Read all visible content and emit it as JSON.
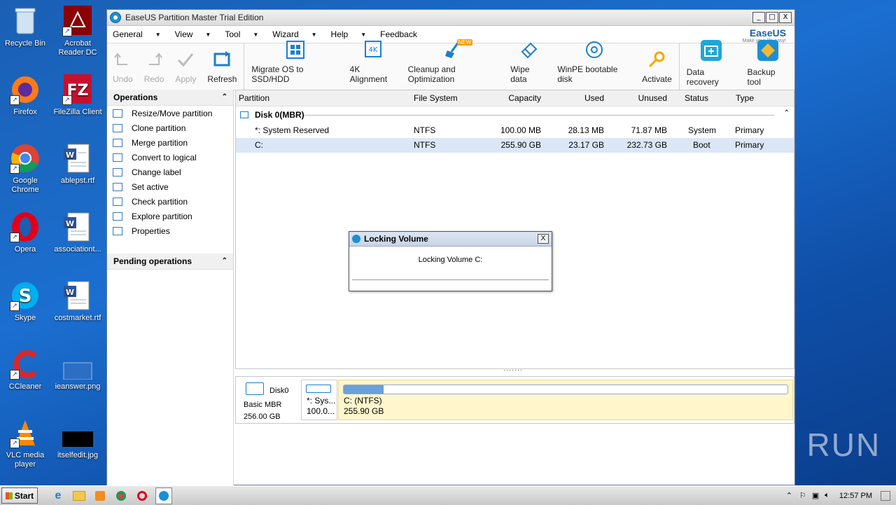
{
  "desktop": {
    "icons": [
      {
        "label": "Recycle Bin"
      },
      {
        "label": "Acrobat Reader DC"
      },
      {
        "label": "Firefox"
      },
      {
        "label": "FileZilla Client"
      },
      {
        "label": "Google Chrome"
      },
      {
        "label": "ablepst.rtf"
      },
      {
        "label": "Opera"
      },
      {
        "label": "associationt..."
      },
      {
        "label": "Skype"
      },
      {
        "label": "costmarket.rtf"
      },
      {
        "label": "CCleaner"
      },
      {
        "label": "ieanswer.png"
      },
      {
        "label": "VLC media player"
      },
      {
        "label": "itselfedit.jpg"
      }
    ]
  },
  "window": {
    "title": "EaseUS Partition Master Trial Edition",
    "buttons": {
      "minimize": "_",
      "maximize": "□",
      "close": "X"
    }
  },
  "menu": {
    "items": [
      "General",
      "View",
      "Tool",
      "Wizard",
      "Help",
      "Feedback"
    ],
    "logo_brand": "EaseUS",
    "logo_tag": "Make your life easy!"
  },
  "toolbar": {
    "undo": "Undo",
    "redo": "Redo",
    "apply": "Apply",
    "refresh": "Refresh",
    "migrate": "Migrate OS to SSD/HDD",
    "align4k": "4K Alignment",
    "cleanup": "Cleanup and Optimization",
    "new_badge": "NEW",
    "wipe": "Wipe data",
    "winpe": "WinPE bootable disk",
    "activate": "Activate",
    "data_recovery": "Data recovery",
    "backup": "Backup tool"
  },
  "operations": {
    "header": "Operations",
    "items": [
      "Resize/Move partition",
      "Clone partition",
      "Merge partition",
      "Convert to logical",
      "Change label",
      "Set active",
      "Check partition",
      "Explore partition",
      "Properties"
    ]
  },
  "pending": {
    "header": "Pending operations"
  },
  "table": {
    "headers": [
      "Partition",
      "File System",
      "Capacity",
      "Used",
      "Unused",
      "Status",
      "Type"
    ],
    "disk_label": "Disk 0(MBR)",
    "rows": [
      {
        "partition": "*: System Reserved",
        "fs": "NTFS",
        "capacity": "100.00 MB",
        "used": "28.13 MB",
        "unused": "71.87 MB",
        "status": "System",
        "type": "Primary"
      },
      {
        "partition": "C:",
        "fs": "NTFS",
        "capacity": "255.90 GB",
        "used": "23.17 GB",
        "unused": "232.73 GB",
        "status": "Boot",
        "type": "Primary"
      }
    ]
  },
  "diskmap": {
    "disk_name": "Disk0",
    "disk_type": "Basic MBR",
    "disk_size": "256.00 GB",
    "part1_label": "*: Sys...",
    "part1_size": "100.0...",
    "part2_label": "C: (NTFS)",
    "part2_size": "255.90 GB",
    "c_used_fraction": 0.09
  },
  "dialog": {
    "title": "Locking Volume",
    "message": "Locking Volume C:",
    "close": "X"
  },
  "taskbar": {
    "start": "Start",
    "time": "12:57 PM"
  },
  "watermark": "ANY RUN"
}
